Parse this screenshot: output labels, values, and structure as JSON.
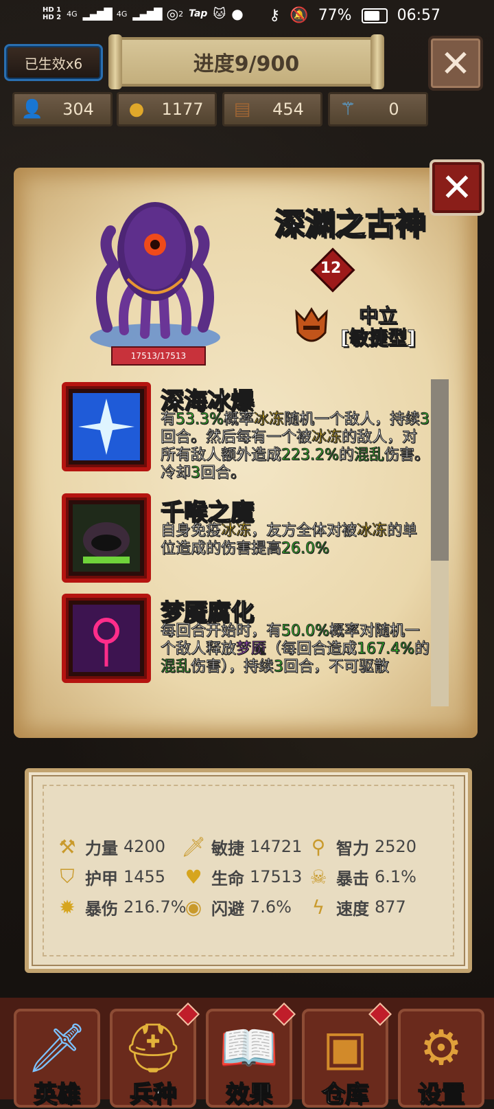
{
  "status_bar": {
    "hd1": "HD 1",
    "hd2": "HD 2",
    "net1": "4G",
    "net2": "4G",
    "hotspot_count": "2",
    "tap_label": "Tap",
    "battery": "77%",
    "time": "06:57"
  },
  "top": {
    "buff_label": "已生效x6",
    "progress": "进度9/900"
  },
  "resources": [
    {
      "icon": "population-icon",
      "value": "304"
    },
    {
      "icon": "gold-coins-icon",
      "value": "1177"
    },
    {
      "icon": "wood-logs-icon",
      "value": "454"
    },
    {
      "icon": "crystal-staff-icon",
      "value": "0"
    }
  ],
  "boss": {
    "name": "深渊之古神",
    "level": "12",
    "hp": "17513/17513",
    "alignment": "中立",
    "type": "[敏捷型]"
  },
  "skills": [
    {
      "title": "深海冰爆",
      "desc": [
        {
          "t": "有",
          "c": ""
        },
        {
          "t": "53.3%",
          "c": "g"
        },
        {
          "t": "概率",
          "c": ""
        },
        {
          "t": "冰冻",
          "c": "y"
        },
        {
          "t": "随机一个敌人，持续",
          "c": ""
        },
        {
          "t": "3",
          "c": "g"
        },
        {
          "t": "回合。然后每有一个被",
          "c": ""
        },
        {
          "t": "冰冻",
          "c": "y"
        },
        {
          "t": "的敌人，对所有敌人额外造成",
          "c": ""
        },
        {
          "t": "223.2%",
          "c": "g"
        },
        {
          "t": "的",
          "c": ""
        },
        {
          "t": "混乱",
          "c": "g"
        },
        {
          "t": "伤害。冷却",
          "c": ""
        },
        {
          "t": "3",
          "c": "g"
        },
        {
          "t": "回合。",
          "c": ""
        }
      ]
    },
    {
      "title": "千喉之魔",
      "desc": [
        {
          "t": "自身免疫",
          "c": ""
        },
        {
          "t": "冰冻",
          "c": "y"
        },
        {
          "t": "，友方全体对被",
          "c": ""
        },
        {
          "t": "冰冻",
          "c": "y"
        },
        {
          "t": "的单位造成的伤害提高",
          "c": ""
        },
        {
          "t": "26.0%",
          "c": "g"
        }
      ]
    },
    {
      "title": "梦魇腐化",
      "desc": [
        {
          "t": "每回合开始时，有",
          "c": ""
        },
        {
          "t": "50.0%",
          "c": "g"
        },
        {
          "t": "概率对随机一个敌人释放",
          "c": ""
        },
        {
          "t": "梦魇",
          "c": "p"
        },
        {
          "t": "（每回合造成",
          "c": ""
        },
        {
          "t": "167.4%",
          "c": "g"
        },
        {
          "t": "的",
          "c": ""
        },
        {
          "t": "混乱",
          "c": "g"
        },
        {
          "t": "伤害），持续",
          "c": ""
        },
        {
          "t": "3",
          "c": "g"
        },
        {
          "t": "回合，不可驱散",
          "c": ""
        }
      ]
    }
  ],
  "stats": [
    {
      "icon": "axe-icon",
      "label": "力量",
      "value": "4200"
    },
    {
      "icon": "sword-icon",
      "label": "敏捷",
      "value": "14721"
    },
    {
      "icon": "staff-icon",
      "label": "智力",
      "value": "2520"
    },
    {
      "icon": "shield-icon",
      "label": "护甲",
      "value": "1455"
    },
    {
      "icon": "heart-icon",
      "label": "生命",
      "value": "17513"
    },
    {
      "icon": "skull-icon",
      "label": "暴击",
      "value": "6.1%"
    },
    {
      "icon": "burst-icon",
      "label": "暴伤",
      "value": "216.7%"
    },
    {
      "icon": "eye-icon",
      "label": "闪避",
      "value": "7.6%"
    },
    {
      "icon": "lightning-icon",
      "label": "速度",
      "value": "877"
    }
  ],
  "nav": [
    {
      "icon": "sword-icon",
      "label": "英雄",
      "badge": false
    },
    {
      "icon": "helmet-icon",
      "label": "兵种",
      "badge": true
    },
    {
      "icon": "book-icon",
      "label": "效果",
      "badge": true
    },
    {
      "icon": "chest-icon",
      "label": "仓库",
      "badge": true
    },
    {
      "icon": "gear-icon",
      "label": "设置",
      "badge": false
    }
  ],
  "colors": {
    "highlight_yellow": "#f6c81d",
    "highlight_green": "#39d12b",
    "highlight_purple": "#d057ff",
    "panel_close_red": "#8a1e19"
  }
}
